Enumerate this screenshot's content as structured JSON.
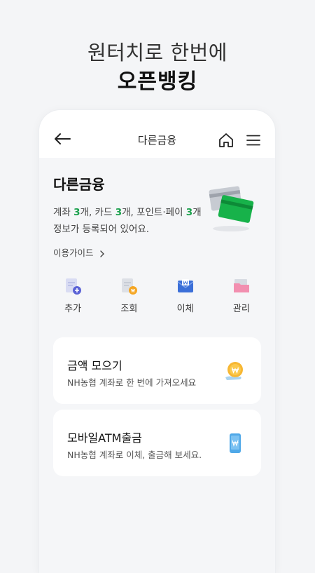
{
  "promo": {
    "line1": "원터치로 한번에",
    "line2": "오픈뱅킹"
  },
  "topbar": {
    "title": "다른금융",
    "back_icon": "arrow-left-icon",
    "home_icon": "home-icon",
    "menu_icon": "hamburger-menu-icon"
  },
  "summary": {
    "title": "다른금융",
    "t1": "계좌 ",
    "n1": "3",
    "t2": "개, 카드 ",
    "n2": "3",
    "t3": "개, 포인트·페이 ",
    "n3": "3",
    "t4": "개",
    "t5": "정보가 등록되어 있어요.",
    "guide_label": "이용가이드",
    "accent_color": "#1aa04c"
  },
  "actions": [
    {
      "label": "추가",
      "icon": "document-plus-icon"
    },
    {
      "label": "조회",
      "icon": "document-coin-icon"
    },
    {
      "label": "이체",
      "icon": "envelope-won-icon"
    },
    {
      "label": "관리",
      "icon": "folder-icon"
    }
  ],
  "menu_cards": [
    {
      "title": "금액 모으기",
      "desc": "NH농협 계좌로 한 번에 가져오세요",
      "icon": "coin-hand-icon"
    },
    {
      "title": "모바일ATM출금",
      "desc": "NH농협 계좌로 이체, 출금해 보세요.",
      "icon": "mobile-won-icon"
    }
  ]
}
